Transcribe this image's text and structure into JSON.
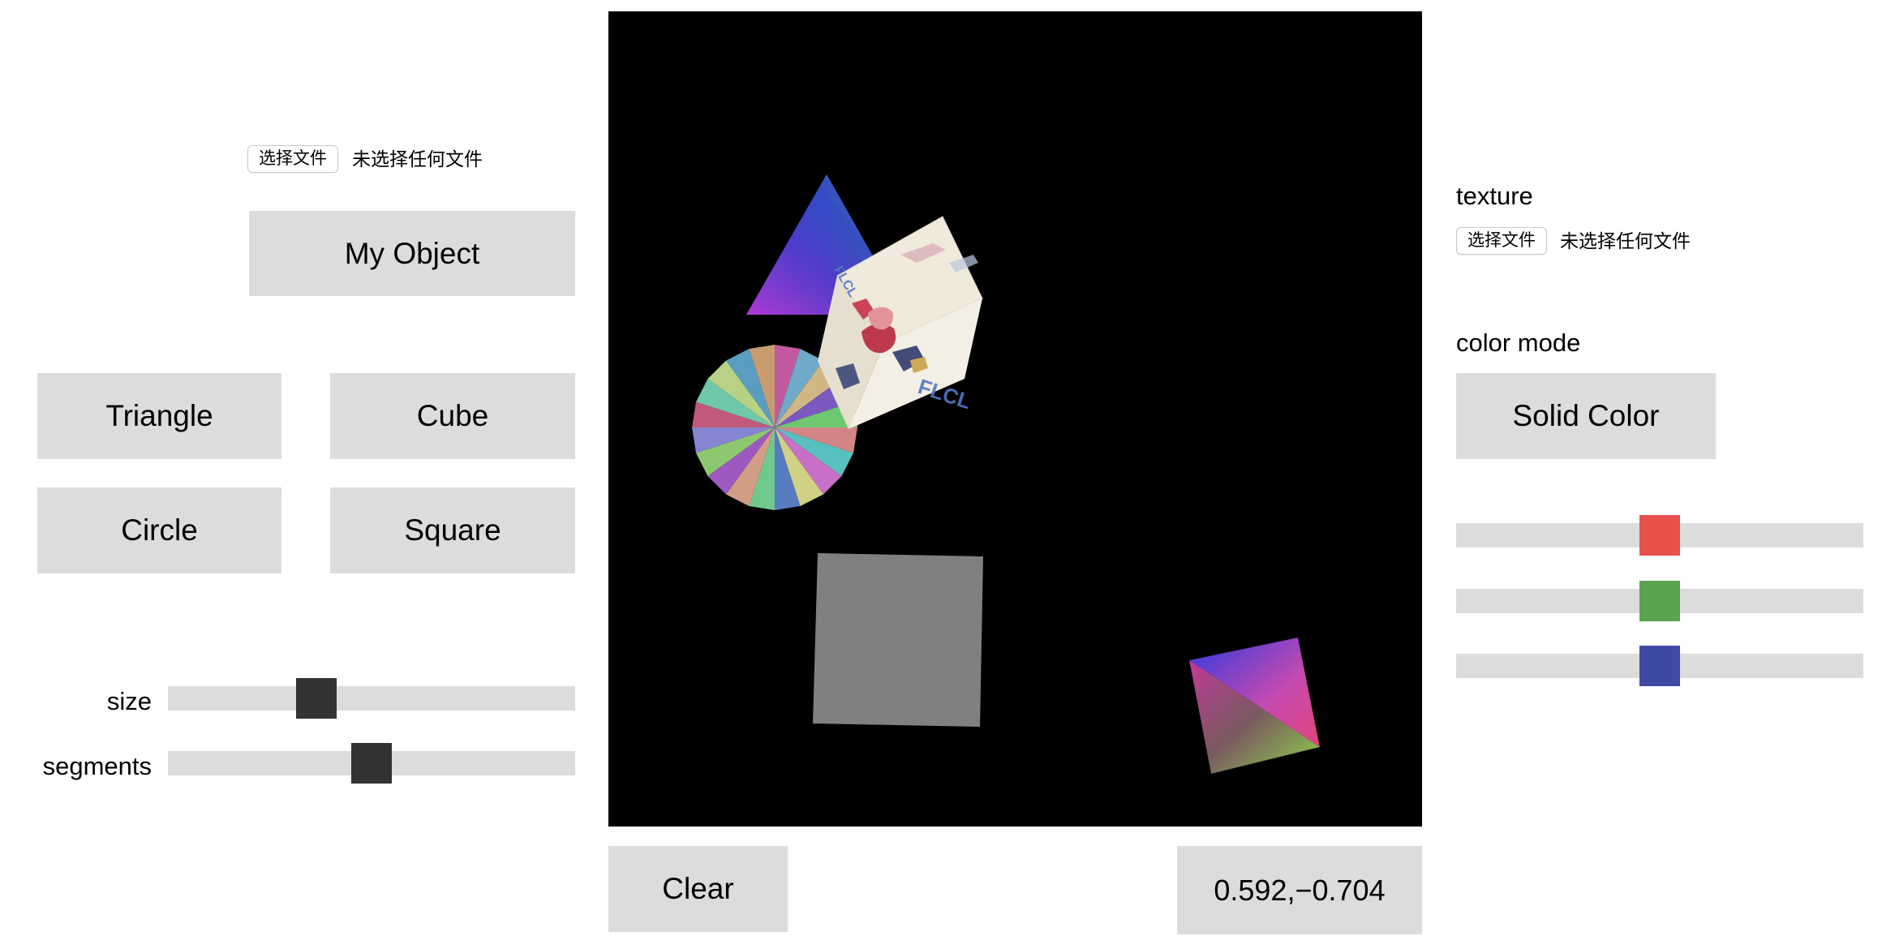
{
  "left_panel": {
    "object_file": {
      "button_label": "选择文件",
      "status_text": "未选择任何文件"
    },
    "my_object_label": "My Object",
    "shape_buttons": {
      "triangle": "Triangle",
      "cube": "Cube",
      "circle": "Circle",
      "square": "Square"
    },
    "sliders": {
      "size_label": "size",
      "size_value": 0.35,
      "segments_label": "segments",
      "segments_value": 0.5
    }
  },
  "right_panel": {
    "texture_label": "texture",
    "texture_file": {
      "button_label": "选择文件",
      "status_text": "未选择任何文件"
    },
    "color_mode_label": "color mode",
    "color_mode_button": "Solid Color",
    "color_sliders": [
      {
        "name": "red",
        "value": 0.5,
        "color": "#e8514a"
      },
      {
        "name": "green",
        "value": 0.5,
        "color": "#5ba34f"
      },
      {
        "name": "blue",
        "value": 0.5,
        "color": "#3e4aa3"
      }
    ]
  },
  "bottom_bar": {
    "clear_label": "Clear",
    "coordinate_readout": "0.592,−0.704"
  },
  "colors": {
    "button_bg": "#dcdcdc",
    "canvas_bg": "#000000",
    "slider_thumb": "#333333",
    "square_fill": "#808080"
  }
}
